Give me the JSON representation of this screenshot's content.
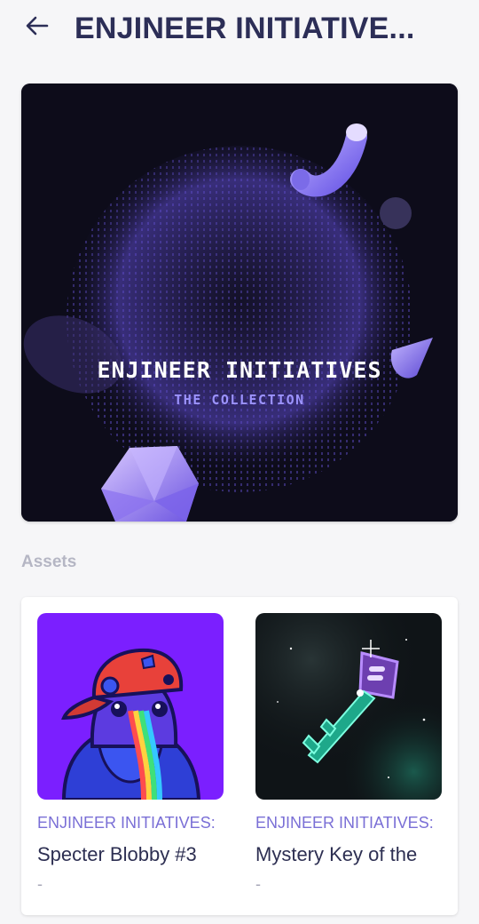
{
  "header": {
    "title": "ENJINEER INITIATIVE...",
    "back_icon": "arrow-left-icon"
  },
  "banner": {
    "title": "ENJINEER INITIATIVES",
    "subtitle": "THE COLLECTION"
  },
  "assets": {
    "section_label": "Assets",
    "items": [
      {
        "collection": "ENJINEER INITIATIVES:",
        "name": "Specter Blobby #3",
        "price": "-",
        "image": "specter-blobby-image"
      },
      {
        "collection": "ENJINEER INITIATIVES:",
        "name": "Mystery Key of the",
        "price": "-",
        "image": "mystery-key-image"
      }
    ]
  },
  "colors": {
    "title": "#2c2e57",
    "accent": "#7a6fd6",
    "banner_bg": "#0d0c1a",
    "blobby_bg": "#7b1fff"
  }
}
